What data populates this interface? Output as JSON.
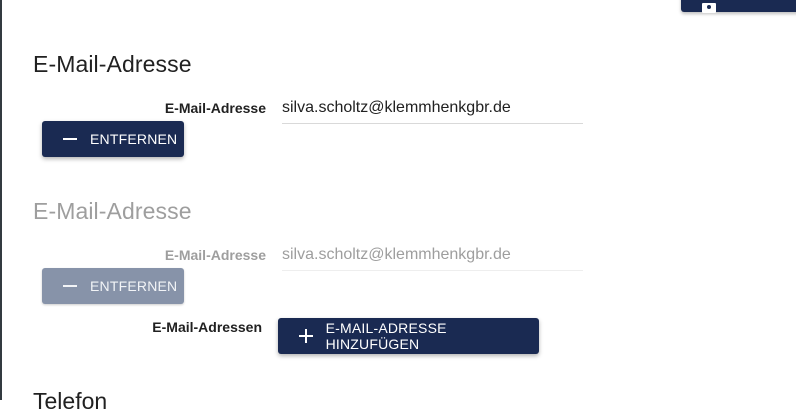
{
  "email_section_1": {
    "title": "E-Mail-Adresse",
    "field_label": "E-Mail-Adresse",
    "value": "silva.scholtz@klemmhenkgbr.de",
    "remove_label": "ENTFERNEN"
  },
  "email_section_2": {
    "title": "E-Mail-Adresse",
    "field_label": "E-Mail-Adresse",
    "value": "silva.scholtz@klemmhenkgbr.de",
    "remove_label": "ENTFERNEN",
    "disabled": true
  },
  "add_email": {
    "label": "E-Mail-Adressen",
    "button_label": "E-MAIL-ADRESSE HINZUFÜGEN"
  },
  "next_section": {
    "title": "Telefon"
  },
  "colors": {
    "primary": "#1a2a52",
    "primary_disabled": "#8793a9",
    "text": "#212121",
    "text_disabled": "#9e9e9e"
  },
  "icons": {
    "top_button": "save-icon",
    "remove": "minus-icon",
    "add": "plus-icon"
  }
}
